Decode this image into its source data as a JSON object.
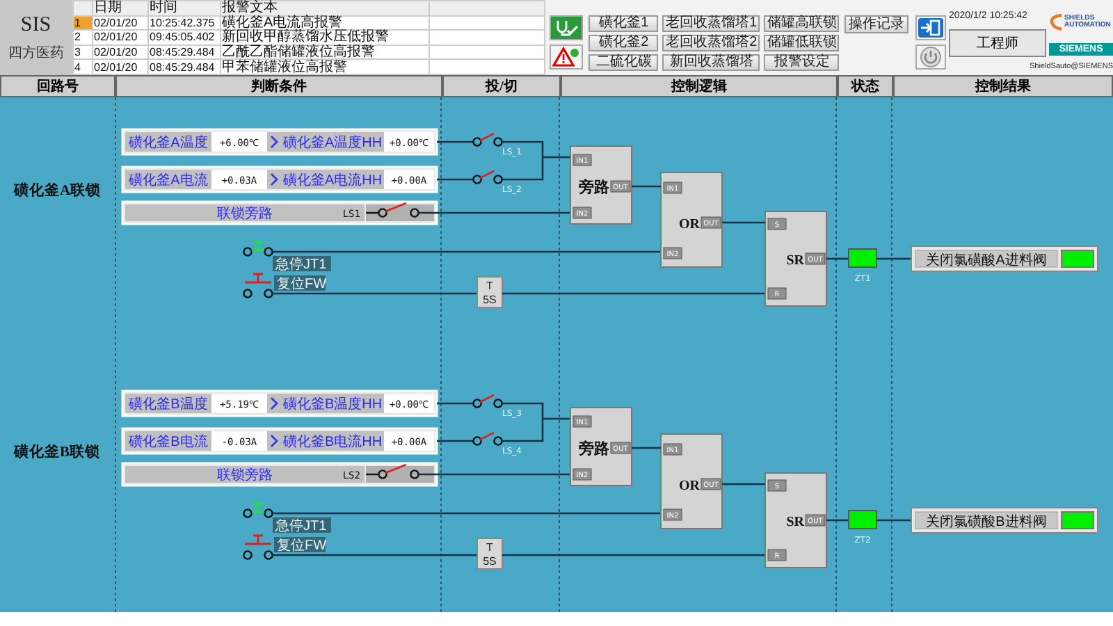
{
  "header": {
    "title": "SIS",
    "company": "四方医药",
    "datetime": "2020/1/2  10:25:42",
    "user": "工程师",
    "logo_text": "SHIELDS AUTOMATION",
    "logo_brand": "SIEMENS",
    "caption": "ShieldSauto@SIEMENS"
  },
  "alarm_table": {
    "columns": [
      "日期",
      "时间",
      "报警文本"
    ],
    "rows": [
      {
        "index": "1",
        "date": "02/01/20",
        "time": "10:25:42.375",
        "text": "磺化釜A电流高报警",
        "selected": true
      },
      {
        "index": "2",
        "date": "02/01/20",
        "time": "09:45:05.402",
        "text": "新回收甲醇蒸馏水压低报警",
        "selected": false
      },
      {
        "index": "3",
        "date": "02/01/20",
        "time": "08:45:29.484",
        "text": "乙酰乙酯储罐液位高报警",
        "selected": false
      },
      {
        "index": "4",
        "date": "02/01/20",
        "time": "08:45:29.484",
        "text": "甲苯储罐液位高报警",
        "selected": false
      }
    ]
  },
  "nav_buttons": [
    "磺化釜1",
    "老回收蒸馏塔1",
    "储罐高联锁",
    "磺化釜2",
    "老回收蒸馏塔2",
    "储罐低联锁",
    "二硫化碳",
    "新回收蒸馏塔",
    "报警设定"
  ],
  "log_button": "操作记录",
  "columns": [
    "回路号",
    "判断条件",
    "投/切",
    "控制逻辑",
    "状态",
    "控制结果"
  ],
  "loops": [
    {
      "name": "磺化釜A联锁",
      "conditions": [
        {
          "label": "磺化釜A温度",
          "value": "+6.00℃",
          "limit_label": "磺化釜A温度HH",
          "limit": "+0.00℃",
          "switch_tag": "LS_1",
          "closed": false
        },
        {
          "label": "磺化釜A电流",
          "value": "+0.03A",
          "limit_label": "磺化釜A电流HH",
          "limit": "+0.00A",
          "switch_tag": "LS_2",
          "closed": false
        }
      ],
      "bypass": {
        "label": "联锁旁路",
        "tag": "LS1",
        "closed": false
      },
      "estop": {
        "label": "急停JT1",
        "closed": true
      },
      "reset": {
        "label": "复位FW",
        "closed": false
      },
      "timer": {
        "label": "T",
        "delay": "5S"
      },
      "bypass_block": {
        "title": "旁路",
        "inputs": [
          "IN1",
          "IN2"
        ],
        "output": "OUT"
      },
      "or_block": {
        "title": "OR",
        "inputs": [
          "IN1",
          "IN2"
        ],
        "output": "OUT"
      },
      "sr_block": {
        "title": "SR",
        "inputs": [
          "S",
          "R"
        ],
        "output": "OUT"
      },
      "status": {
        "tag": "ZT1",
        "on": true
      },
      "result": {
        "label": "关闭氯磺酸A进料阀",
        "on": true
      }
    },
    {
      "name": "磺化釜B联锁",
      "conditions": [
        {
          "label": "磺化釜B温度",
          "value": "+5.19℃",
          "limit_label": "磺化釜B温度HH",
          "limit": "+0.00℃",
          "switch_tag": "LS_3",
          "closed": false
        },
        {
          "label": "磺化釜B电流",
          "value": "-0.03A",
          "limit_label": "磺化釜B电流HH",
          "limit": "+0.00A",
          "switch_tag": "LS_4",
          "closed": false
        }
      ],
      "bypass": {
        "label": "联锁旁路",
        "tag": "LS2",
        "closed": false
      },
      "estop": {
        "label": "急停JT1",
        "closed": true
      },
      "reset": {
        "label": "复位FW",
        "closed": false
      },
      "timer": {
        "label": "T",
        "delay": "5S"
      },
      "bypass_block": {
        "title": "旁路",
        "inputs": [
          "IN1",
          "IN2"
        ],
        "output": "OUT"
      },
      "or_block": {
        "title": "OR",
        "inputs": [
          "IN1",
          "IN2"
        ],
        "output": "OUT"
      },
      "sr_block": {
        "title": "SR",
        "inputs": [
          "S",
          "R"
        ],
        "output": "OUT"
      },
      "status": {
        "tag": "ZT2",
        "on": true
      },
      "result": {
        "label": "关闭氯磺酸B进料阀",
        "on": true
      }
    }
  ]
}
